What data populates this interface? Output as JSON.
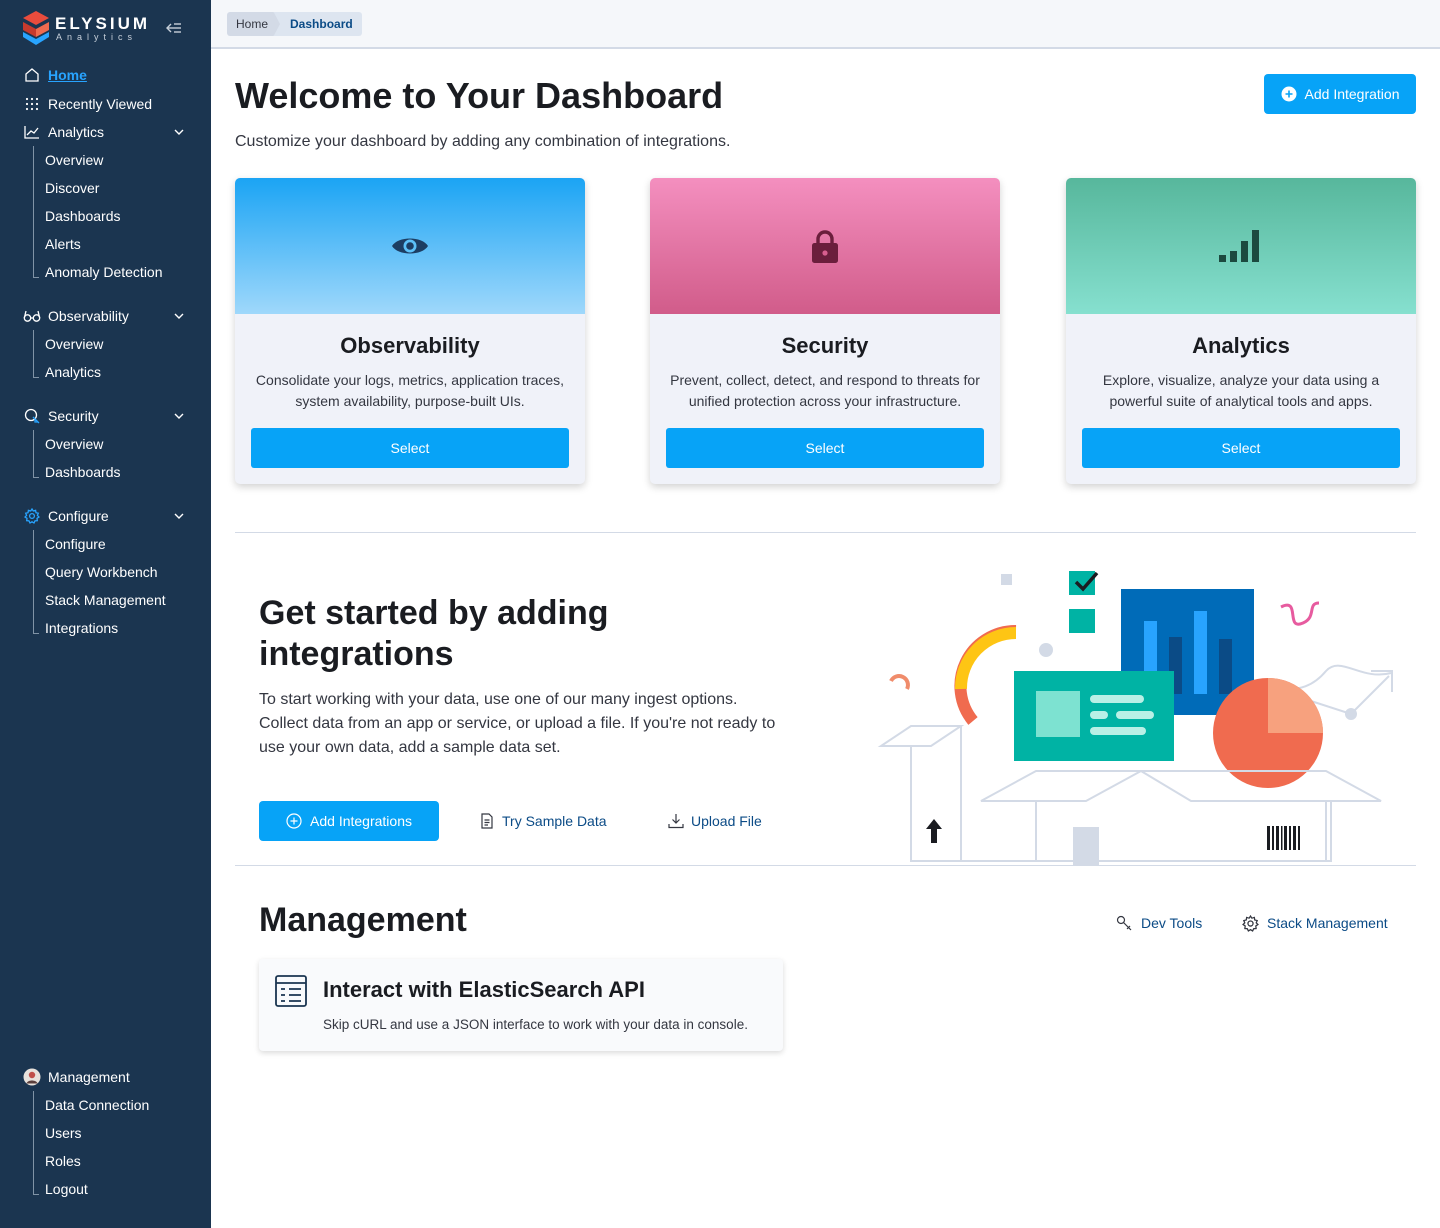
{
  "brand": {
    "name": "ELYSIUM",
    "subtitle": "Analytics"
  },
  "sidebar": {
    "home": "Home",
    "recently_viewed": "Recently Viewed",
    "analytics": {
      "label": "Analytics",
      "items": [
        "Overview",
        "Discover",
        "Dashboards",
        "Alerts",
        "Anomaly Detection"
      ]
    },
    "observability": {
      "label": "Observability",
      "items": [
        "Overview",
        "Analytics"
      ]
    },
    "security": {
      "label": "Security",
      "items": [
        "Overview",
        "Dashboards"
      ]
    },
    "configure": {
      "label": "Configure",
      "items": [
        "Configure",
        "Query Workbench",
        "Stack Management",
        "Integrations"
      ]
    },
    "management": {
      "label": "Management",
      "items": [
        "Data Connection",
        "Users",
        "Roles",
        "Logout"
      ]
    }
  },
  "breadcrumb": {
    "home": "Home",
    "current": "Dashboard"
  },
  "header": {
    "title": "Welcome to Your Dashboard",
    "subtitle": "Customize your dashboard by adding any combination of integrations.",
    "add_integration": "Add Integration"
  },
  "cards": [
    {
      "title": "Observability",
      "description": "Consolidate your logs, metrics, application traces, system availability, purpose-built UIs.",
      "button": "Select",
      "icon": "eye-icon",
      "gradient": [
        "#1ba4f4",
        "#9fd8fb"
      ]
    },
    {
      "title": "Security",
      "description": "Prevent, collect, detect, and respond to threats for unified protection across your infrastructure.",
      "button": "Select",
      "icon": "lock-icon",
      "gradient": [
        "#f48fbf",
        "#d15c8a"
      ]
    },
    {
      "title": "Analytics",
      "description": "Explore, visualize, analyze your data using a powerful suite of analytical tools and apps.",
      "button": "Select",
      "icon": "signal-bars-icon",
      "gradient": [
        "#57b79c",
        "#86e0cf"
      ]
    }
  ],
  "get_started": {
    "title": "Get started by adding integrations",
    "description": "To start working with your data, use one of our many ingest options. Collect data from an app or service, or upload a file. If you're not ready to use your own data, add a sample data set.",
    "add_integrations": "Add Integrations",
    "try_sample": "Try Sample Data",
    "upload_file": "Upload File"
  },
  "management": {
    "title": "Management",
    "dev_tools": "Dev Tools",
    "stack_management": "Stack Management",
    "api_card": {
      "title": "Interact with ElasticSearch API",
      "description": "Skip cURL and use a JSON interface to work with your data in console."
    }
  },
  "colors": {
    "sidebar": "#1b3550",
    "primary": "#07a3f7",
    "link": "#0b4b86"
  }
}
